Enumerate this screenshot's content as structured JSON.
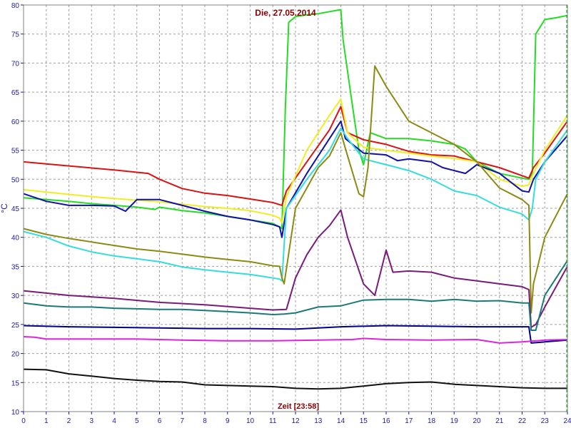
{
  "chart_data": {
    "type": "line",
    "title": "Die, 27.05.2014",
    "xlabel": "Zeit [23:58]",
    "ylabel": "°C",
    "xlim": [
      0,
      24
    ],
    "ylim": [
      10,
      80
    ],
    "x_ticks": [
      0,
      1,
      2,
      3,
      4,
      5,
      6,
      7,
      8,
      9,
      10,
      11,
      12,
      13,
      14,
      15,
      16,
      17,
      18,
      19,
      20,
      21,
      22,
      23,
      24
    ],
    "y_ticks": [
      10,
      15,
      20,
      25,
      30,
      35,
      40,
      45,
      50,
      55,
      60,
      65,
      70,
      75,
      80
    ],
    "grid": true,
    "series": [
      {
        "color": "#22dd22",
        "points": [
          [
            0,
            46.8
          ],
          [
            1,
            46.5
          ],
          [
            2,
            46.2
          ],
          [
            3,
            45.8
          ],
          [
            4,
            45.5
          ],
          [
            5,
            45.2
          ],
          [
            5.8,
            44.8
          ],
          [
            6,
            45.2
          ],
          [
            7,
            44.6
          ],
          [
            8,
            44.2
          ],
          [
            9,
            43.6
          ],
          [
            10,
            43.0
          ],
          [
            11,
            42.4
          ],
          [
            11.3,
            41.8
          ],
          [
            11.4,
            41.5
          ],
          [
            11.55,
            62
          ],
          [
            11.7,
            77
          ],
          [
            12,
            78
          ],
          [
            12.5,
            78.3
          ],
          [
            13,
            78.5
          ],
          [
            14,
            79.2
          ],
          [
            14.1,
            74
          ],
          [
            14.5,
            63
          ],
          [
            14.8,
            55
          ],
          [
            15.0,
            52.5
          ],
          [
            15.3,
            58
          ],
          [
            16,
            57
          ],
          [
            17,
            57
          ],
          [
            18,
            56.6
          ],
          [
            19,
            56
          ],
          [
            19.5,
            55.2
          ],
          [
            20,
            53
          ],
          [
            20.5,
            52
          ],
          [
            21,
            51
          ],
          [
            22,
            50.2
          ],
          [
            22.3,
            50.0
          ],
          [
            22.45,
            51
          ],
          [
            22.6,
            75
          ],
          [
            23,
            77.5
          ],
          [
            23.5,
            77.8
          ],
          [
            24,
            78.2
          ]
        ]
      },
      {
        "color": "#dd1111",
        "points": [
          [
            0,
            53.0
          ],
          [
            2,
            52.3
          ],
          [
            4,
            51.6
          ],
          [
            5.5,
            51.0
          ],
          [
            6,
            50.0
          ],
          [
            7,
            48.4
          ],
          [
            8,
            47.6
          ],
          [
            9,
            47.2
          ],
          [
            10,
            46.6
          ],
          [
            11,
            46.0
          ],
          [
            11.4,
            45.5
          ],
          [
            11.6,
            48
          ],
          [
            12.5,
            53
          ],
          [
            13.5,
            58.5
          ],
          [
            14,
            62.5
          ],
          [
            14.3,
            58
          ],
          [
            15,
            56.8
          ],
          [
            16,
            56
          ],
          [
            17,
            54.8
          ],
          [
            18,
            54.2
          ],
          [
            19,
            54
          ],
          [
            20,
            53
          ],
          [
            21,
            52
          ],
          [
            22.3,
            50.2
          ],
          [
            22.5,
            52
          ],
          [
            23,
            54.5
          ],
          [
            24,
            60.0
          ]
        ]
      },
      {
        "color": "#eeee22",
        "points": [
          [
            0,
            48.2
          ],
          [
            1,
            47.8
          ],
          [
            2,
            47.4
          ],
          [
            3,
            47.0
          ],
          [
            4,
            46.7
          ],
          [
            5,
            46.4
          ],
          [
            6,
            46.1
          ],
          [
            7,
            45.7
          ],
          [
            8,
            45.3
          ],
          [
            9,
            45.0
          ],
          [
            10,
            44.6
          ],
          [
            11,
            43.8
          ],
          [
            11.3,
            43.3
          ],
          [
            11.4,
            42.5
          ],
          [
            11.6,
            47
          ],
          [
            12.5,
            55
          ],
          [
            13.5,
            61
          ],
          [
            14,
            63.8
          ],
          [
            14.3,
            58
          ],
          [
            15,
            55.5
          ],
          [
            16,
            55
          ],
          [
            17,
            54.5
          ],
          [
            18,
            54
          ],
          [
            19,
            53.6
          ],
          [
            20,
            53
          ],
          [
            21,
            50
          ],
          [
            22,
            48.8
          ],
          [
            22.3,
            49
          ],
          [
            22.5,
            51
          ],
          [
            23,
            55
          ],
          [
            24,
            61.0
          ]
        ]
      },
      {
        "color": "#1111aa",
        "points": [
          [
            0,
            47.5
          ],
          [
            1,
            46.2
          ],
          [
            2,
            45.5
          ],
          [
            3,
            45.5
          ],
          [
            4,
            45.4
          ],
          [
            4.5,
            44.5
          ],
          [
            5,
            46.5
          ],
          [
            6,
            46.5
          ],
          [
            6.5,
            46
          ],
          [
            7,
            45.5
          ],
          [
            8,
            44.5
          ],
          [
            9,
            43.6
          ],
          [
            10,
            43.0
          ],
          [
            11,
            42.2
          ],
          [
            11.3,
            41.8
          ],
          [
            11.4,
            40.0
          ],
          [
            11.6,
            45
          ],
          [
            12.5,
            51
          ],
          [
            13.5,
            57
          ],
          [
            14,
            60.0
          ],
          [
            14.2,
            57
          ],
          [
            15,
            54.5
          ],
          [
            16,
            54.2
          ],
          [
            16.5,
            53.2
          ],
          [
            17,
            53.5
          ],
          [
            18,
            53
          ],
          [
            18.5,
            52
          ],
          [
            19,
            51.5
          ],
          [
            19.5,
            51
          ],
          [
            20,
            52.5
          ],
          [
            21,
            51
          ],
          [
            22,
            48
          ],
          [
            22.3,
            47.8
          ],
          [
            22.5,
            50
          ],
          [
            23,
            53
          ],
          [
            24,
            57.5
          ]
        ]
      },
      {
        "color": "#33dddd",
        "points": [
          [
            0,
            41.0
          ],
          [
            1,
            40.0
          ],
          [
            2,
            38.5
          ],
          [
            3,
            37.5
          ],
          [
            4,
            36.8
          ],
          [
            5,
            36.3
          ],
          [
            6,
            35.8
          ],
          [
            7,
            34.9
          ],
          [
            8,
            34.4
          ],
          [
            9,
            34.0
          ],
          [
            10,
            33.6
          ],
          [
            11,
            33.0
          ],
          [
            11.3,
            32.8
          ],
          [
            11.4,
            32.5
          ],
          [
            11.6,
            45
          ],
          [
            12.5,
            50
          ],
          [
            13.5,
            55
          ],
          [
            14,
            58.8
          ],
          [
            14.3,
            57
          ],
          [
            15,
            53.5
          ],
          [
            16,
            52.5
          ],
          [
            17,
            51.5
          ],
          [
            18,
            50
          ],
          [
            19,
            48
          ],
          [
            20,
            47.2
          ],
          [
            21,
            45.2
          ],
          [
            22,
            44
          ],
          [
            22.3,
            43
          ],
          [
            22.45,
            45
          ],
          [
            22.6,
            50
          ],
          [
            23,
            53
          ],
          [
            24,
            58.5
          ]
        ]
      },
      {
        "color": "#8b8b11",
        "points": [
          [
            0,
            41.5
          ],
          [
            1,
            40.5
          ],
          [
            2,
            39.8
          ],
          [
            3,
            39.2
          ],
          [
            4,
            38.6
          ],
          [
            5,
            38.0
          ],
          [
            6,
            37.6
          ],
          [
            7,
            37.1
          ],
          [
            8,
            36.6
          ],
          [
            9,
            36.2
          ],
          [
            10,
            35.8
          ],
          [
            11,
            35.1
          ],
          [
            11.3,
            35.0
          ],
          [
            11.4,
            33.0
          ],
          [
            11.5,
            32.0
          ],
          [
            12,
            45
          ],
          [
            13,
            52
          ],
          [
            13.5,
            54
          ],
          [
            14,
            58
          ],
          [
            14.3,
            54
          ],
          [
            14.8,
            47.5
          ],
          [
            15,
            47
          ],
          [
            15.2,
            52
          ],
          [
            15.5,
            69.5
          ],
          [
            16,
            66
          ],
          [
            17,
            60
          ],
          [
            18,
            58
          ],
          [
            19,
            56
          ],
          [
            20,
            53
          ],
          [
            21,
            48.5
          ],
          [
            22,
            46.5
          ],
          [
            22.3,
            45.5
          ],
          [
            22.4,
            27
          ],
          [
            22.5,
            32
          ],
          [
            23,
            40
          ],
          [
            24,
            47.5
          ]
        ]
      },
      {
        "color": "#7a1a7a",
        "points": [
          [
            0,
            30.8
          ],
          [
            2,
            30.0
          ],
          [
            4,
            29.5
          ],
          [
            6,
            28.8
          ],
          [
            8,
            28.4
          ],
          [
            10,
            27.8
          ],
          [
            11,
            27.5
          ],
          [
            11.6,
            27.6
          ],
          [
            12,
            33
          ],
          [
            12.5,
            37
          ],
          [
            13,
            40
          ],
          [
            13.5,
            42
          ],
          [
            14,
            44.7
          ],
          [
            14.3,
            40
          ],
          [
            15,
            32
          ],
          [
            15.5,
            30
          ],
          [
            16,
            37.8
          ],
          [
            16.3,
            34
          ],
          [
            17,
            34.2
          ],
          [
            18,
            34
          ],
          [
            19,
            33
          ],
          [
            20,
            32.5
          ],
          [
            21,
            32
          ],
          [
            22,
            31.5
          ],
          [
            22.3,
            31.0
          ],
          [
            22.4,
            24.5
          ],
          [
            22.6,
            25
          ],
          [
            23,
            28
          ],
          [
            24,
            35.0
          ]
        ]
      },
      {
        "color": "#1a7a7a",
        "points": [
          [
            0,
            28.7
          ],
          [
            1,
            28.2
          ],
          [
            2,
            28.0
          ],
          [
            3,
            28.0
          ],
          [
            4,
            27.8
          ],
          [
            5,
            27.7
          ],
          [
            6,
            27.6
          ],
          [
            7,
            27.6
          ],
          [
            8,
            27.4
          ],
          [
            9,
            27.2
          ],
          [
            10,
            27.0
          ],
          [
            11,
            26.7
          ],
          [
            11.5,
            26.8
          ],
          [
            12,
            27.0
          ],
          [
            13,
            28.0
          ],
          [
            14,
            28.2
          ],
          [
            15,
            29.2
          ],
          [
            16,
            29.3
          ],
          [
            17,
            29.3
          ],
          [
            18,
            29.0
          ],
          [
            19,
            29.3
          ],
          [
            20,
            29.0
          ],
          [
            21,
            29.1
          ],
          [
            22,
            28.7
          ],
          [
            22.3,
            28.7
          ],
          [
            22.4,
            24
          ],
          [
            22.6,
            24
          ],
          [
            23,
            30
          ],
          [
            24,
            36.0
          ]
        ]
      },
      {
        "color": "#000088",
        "points": [
          [
            0,
            24.8
          ],
          [
            2,
            24.6
          ],
          [
            4,
            24.5
          ],
          [
            6,
            24.4
          ],
          [
            8,
            24.3
          ],
          [
            10,
            24.3
          ],
          [
            12,
            24.2
          ],
          [
            14,
            24.6
          ],
          [
            16,
            24.8
          ],
          [
            18,
            24.7
          ],
          [
            20,
            24.6
          ],
          [
            22,
            24.6
          ],
          [
            22.3,
            24.6
          ],
          [
            22.4,
            21.8
          ],
          [
            23,
            22.0
          ],
          [
            24,
            22.3
          ]
        ]
      },
      {
        "color": "#dd22dd",
        "points": [
          [
            0,
            22.9
          ],
          [
            0.5,
            22.8
          ],
          [
            1,
            22.5
          ],
          [
            3,
            22.5
          ],
          [
            5,
            22.5
          ],
          [
            7,
            22.3
          ],
          [
            9,
            22.2
          ],
          [
            11,
            22.2
          ],
          [
            13,
            22.3
          ],
          [
            14.5,
            22.4
          ],
          [
            15,
            22.6
          ],
          [
            16,
            22.4
          ],
          [
            18,
            22.3
          ],
          [
            20,
            22.4
          ],
          [
            21,
            21.8
          ],
          [
            22,
            22.0
          ],
          [
            23,
            22.3
          ],
          [
            24,
            22.4
          ]
        ]
      },
      {
        "color": "#111111",
        "points": [
          [
            0,
            17.3
          ],
          [
            1,
            17.2
          ],
          [
            2,
            16.5
          ],
          [
            3,
            16.1
          ],
          [
            4,
            15.7
          ],
          [
            5,
            15.4
          ],
          [
            6,
            15.2
          ],
          [
            7,
            15.1
          ],
          [
            8,
            14.6
          ],
          [
            9,
            14.5
          ],
          [
            10,
            14.4
          ],
          [
            11,
            14.3
          ],
          [
            12,
            14.0
          ],
          [
            13,
            13.9
          ],
          [
            14,
            14.0
          ],
          [
            15,
            14.4
          ],
          [
            16,
            14.8
          ],
          [
            17,
            15.0
          ],
          [
            18,
            15.1
          ],
          [
            19,
            14.7
          ],
          [
            20,
            14.5
          ],
          [
            21,
            14.3
          ],
          [
            22,
            14.1
          ],
          [
            23,
            14.0
          ],
          [
            24,
            14.0
          ]
        ]
      }
    ]
  }
}
